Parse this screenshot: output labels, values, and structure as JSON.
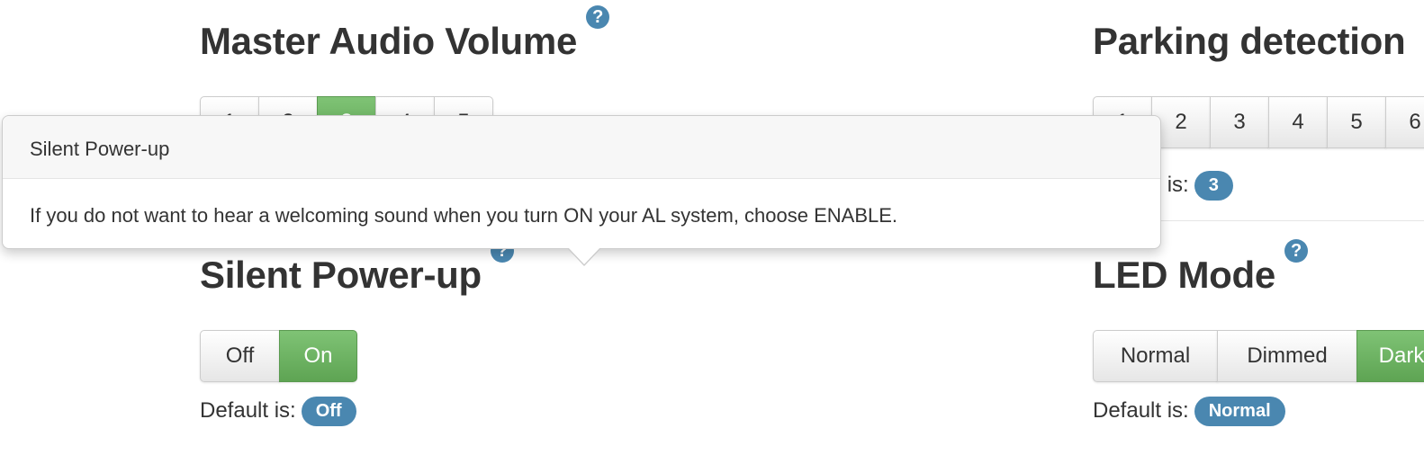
{
  "master_volume": {
    "title": "Master Audio Volume",
    "help": "?",
    "options": [
      "1",
      "2",
      "3",
      "4",
      "5"
    ],
    "selected": "3"
  },
  "parking": {
    "title": "Parking detection",
    "options": [
      "1",
      "2",
      "3",
      "4",
      "5",
      "6"
    ],
    "default_label": "Default is:",
    "default_value": "3"
  },
  "silent": {
    "title": "Silent Power-up",
    "help": "?",
    "options": [
      "Off",
      "On"
    ],
    "selected": "On",
    "default_label": "Default is:",
    "default_value": "Off"
  },
  "led": {
    "title": "LED Mode",
    "help": "?",
    "options": [
      "Normal",
      "Dimmed",
      "Dark"
    ],
    "selected": "Dark",
    "default_label": "Default is:",
    "default_value": "Normal"
  },
  "tooltip": {
    "title": "Silent Power-up",
    "body": "If you do not want to hear a welcoming sound when you turn ON your AL system, choose ENABLE."
  },
  "colors": {
    "accent": "#4a87b0",
    "selected": "#5ea453"
  }
}
